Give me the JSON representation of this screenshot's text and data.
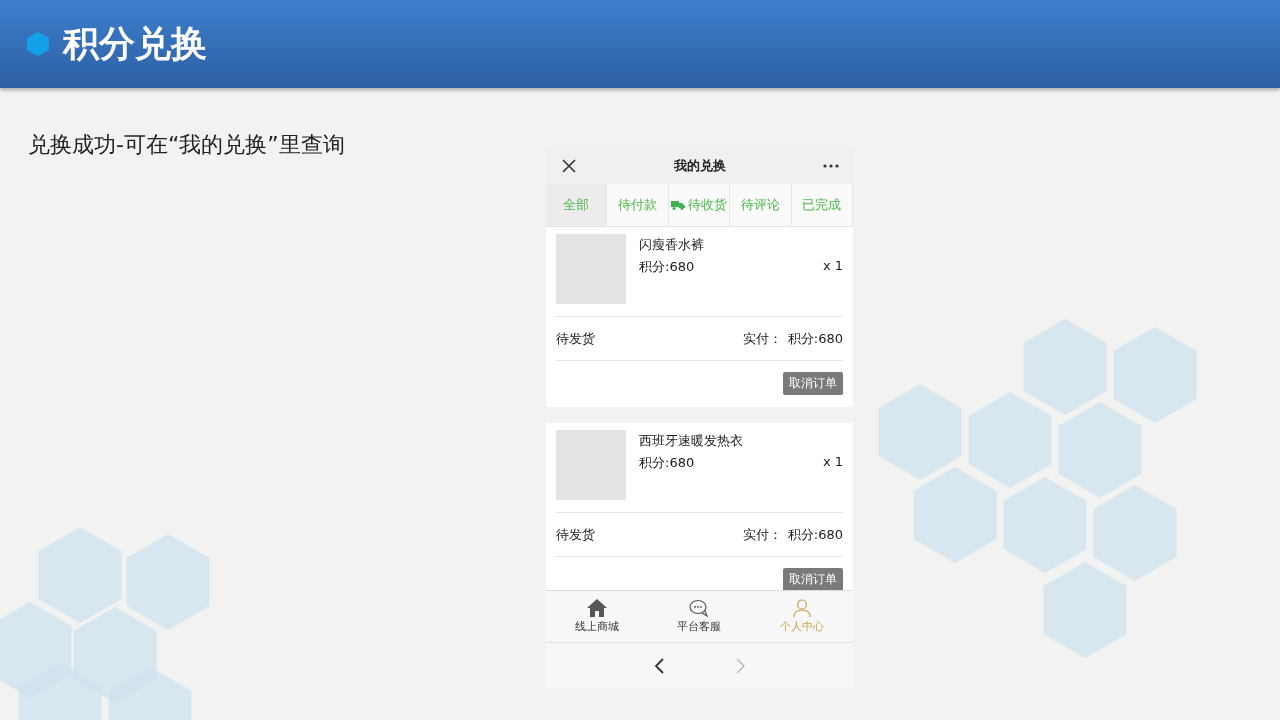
{
  "slide": {
    "title": "积分兑换",
    "caption": "兑换成功-可在“我的兑换”里查询"
  },
  "phone": {
    "title": "我的兑换",
    "tabs": [
      {
        "label": "全部",
        "selected": true,
        "kind": "plain"
      },
      {
        "label": "待付款",
        "selected": false,
        "kind": "plain"
      },
      {
        "label": "待收货",
        "selected": false,
        "kind": "with-icon"
      },
      {
        "label": "待评论",
        "selected": false,
        "kind": "plain"
      },
      {
        "label": "已完成",
        "selected": false,
        "kind": "plain"
      }
    ],
    "orders": [
      {
        "name": "闪瘦香水裤",
        "points": "积分:680",
        "quantity": "x 1",
        "status": "待发货",
        "paid_label": "实付：",
        "paid": "积分:680",
        "action": "取消订单"
      },
      {
        "name": "西班牙速暖发热衣",
        "points": "积分:680",
        "quantity": "x 1",
        "status": "待发货",
        "paid_label": "实付：",
        "paid": "积分:680",
        "action": "取消订单"
      }
    ],
    "tabbar": [
      {
        "label": "线上商城",
        "selected": false
      },
      {
        "label": "平台客服",
        "selected": false
      },
      {
        "label": "个人中心",
        "selected": true
      }
    ]
  }
}
